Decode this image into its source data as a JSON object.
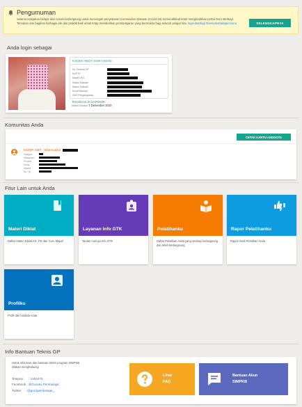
{
  "announcement": {
    "title": "Pengumuman",
    "body": "Selama kebijakan belajar dari rumah berlangsung untuk mencegah penyebaran Coronavirus Disease (Covid-19) Kemendikbud telah menghadirkan portal Guru Berbagi. Temukan dan bagikan berbagai ide dan praktik baik untuk tetap memberikan pembelajaran yang bermakna bagi seluruh pelajar kita.",
    "hashtags": "#gurubarbagi #bersamahadapicorona",
    "button_label": "SELENGKAPNYA"
  },
  "login": {
    "section_title": "Anda login sebagai",
    "name": "KADEK HEDY SURYAWAN",
    "fields": [
      {
        "label": "No. Peserta GP",
        "bar": 30
      },
      {
        "label": "NUPTK",
        "bar": 32
      },
      {
        "label": "Mapel UKG",
        "bar": 44
      },
      {
        "label": "Status Sekolah",
        "bar": 52
      },
      {
        "label": "Status Sekolah",
        "bar": 50
      },
      {
        "label": "Email Sekolah",
        "bar": 64
      },
      {
        "label": "GMT Pengangkatan",
        "bar": 48
      }
    ],
    "sync_label": "Tersinkron di DAPODIK",
    "sync_prefix": "Waktu Sinkron",
    "sync_date": "7 Desember 2020"
  },
  "community": {
    "section_title": "Komunitas Anda",
    "button_label": "CETAK KARTU ANGGOTA",
    "name": "MGMP SMP - Matematika",
    "fields": [
      {
        "label": "Kategori",
        "bar": 6
      },
      {
        "label": "Kabupaten",
        "bar": 30
      },
      {
        "label": "Provinsi",
        "bar": 26
      },
      {
        "label": "Ketua",
        "bar": 38
      },
      {
        "label": "Alamat",
        "bar": 56
      },
      {
        "label": "No. Tlp",
        "bar": 18
      }
    ]
  },
  "features": {
    "section_title": "Fitur Lain untuk Anda",
    "tiles": [
      {
        "name": "Materi Diklat",
        "desc": "Daftar Materi Diklat KS, PS dan Guru Mapel",
        "color": "#00adc3",
        "icon": "book-icon"
      },
      {
        "name": "Layanan Info GTK",
        "desc": "Tautan menuju Info GTK",
        "color": "#673ab7",
        "icon": "id-badge-icon"
      },
      {
        "name": "Pelatihanku",
        "desc": "Daftar Pelatihan Anda yang sedang berlangsung dan telah berlangsung",
        "color": "#f57c00",
        "icon": "reading-icon"
      },
      {
        "name": "Rapor Pelatihanku",
        "desc": "Rapor Hasil Pelatihan Anda",
        "color": "#0e9bdf",
        "icon": "thumbs-icon"
      },
      {
        "name": "Profilku",
        "desc": "Profil dan biodata Anda",
        "color": "#0572c0",
        "icon": "profile-icon"
      }
    ]
  },
  "help": {
    "section_title": "Info Bantuan Teknis GP",
    "intro": "Untuk informasi dan bantuan teknis program SIMPKB silakan menghubungi",
    "telepon_label": "Telepon",
    "telepon_value": ": 1500476",
    "facebook_label": "Facebook",
    "facebook_value": ": @Guruku.Pembelajar",
    "twitter_label": "Twitter",
    "twitter_value": ": @gurupembelajar_",
    "faq_line1": "Lihat",
    "faq_line2": "FAQ",
    "faq_color": "#f7a823",
    "support_line1": "Bantuan Akun",
    "support_line2": "SIMPKB",
    "support_color": "#5b6abf"
  }
}
